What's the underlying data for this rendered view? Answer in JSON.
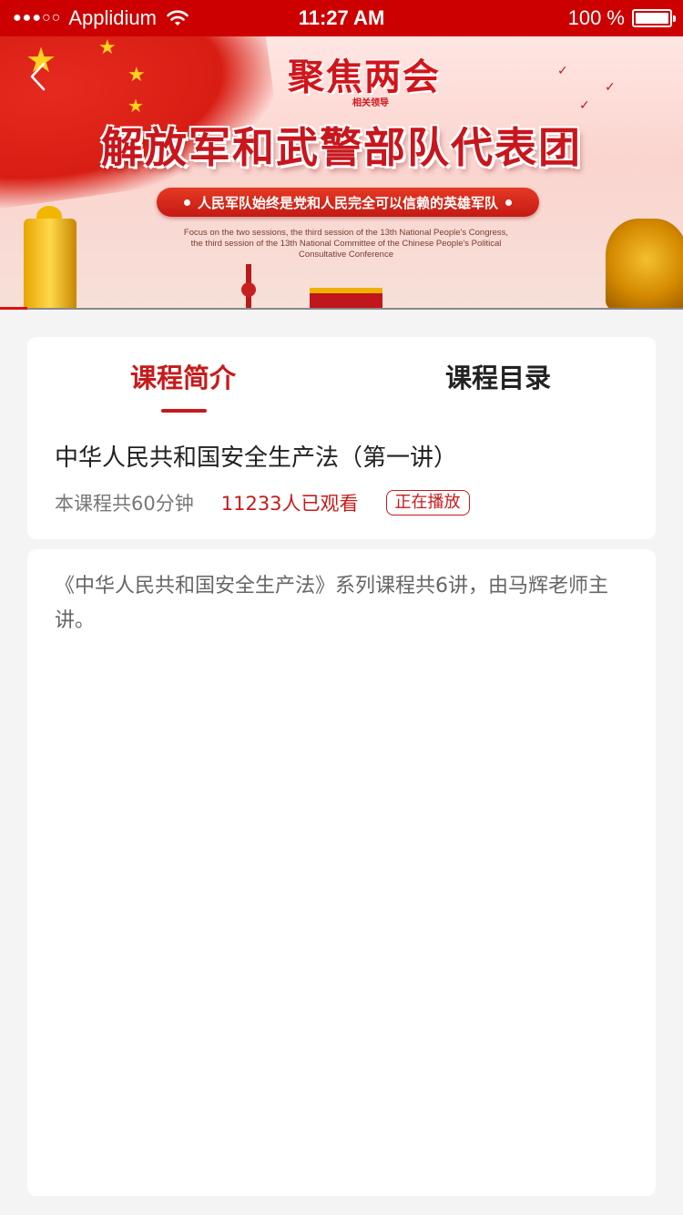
{
  "status_bar": {
    "signal_dots": "●●●○○",
    "carrier": "Applidium",
    "time": "11:27 AM",
    "battery_text": "100 %",
    "battery_level_percent": 100
  },
  "banner": {
    "script_title": "聚焦两会",
    "script_subtag": "相关领导",
    "title": "解放军和武警部队代表团",
    "slogan": "人民军队始终是党和人民完全可以信赖的英雄军队",
    "english_line1": "Focus on the two sessions, the third session of the 13th National People's Congress,",
    "english_line2": "the third session of the 13th National Committee of the Chinese People's Political",
    "english_line3": "Consultative Conference"
  },
  "tabs": {
    "intro": "课程简介",
    "catalog": "课程目录"
  },
  "course": {
    "title": "中华人民共和国安全生产法（第一讲）",
    "duration": "本课程共60分钟",
    "views": "11233人已观看",
    "status_badge": "正在播放"
  },
  "description": {
    "text": "《中华人民共和国安全生产法》系列课程共6讲，由马辉老师主讲。"
  },
  "colors": {
    "accent": "#c81a1a",
    "status_bar": "#cc0000",
    "page_bg": "#f4f4f4"
  }
}
